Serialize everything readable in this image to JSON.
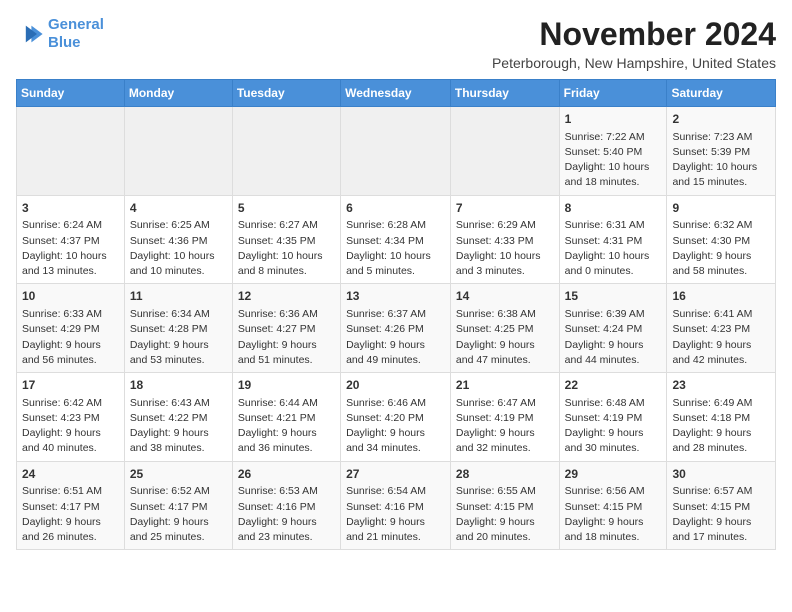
{
  "logo": {
    "line1": "General",
    "line2": "Blue"
  },
  "title": "November 2024",
  "location": "Peterborough, New Hampshire, United States",
  "weekdays": [
    "Sunday",
    "Monday",
    "Tuesday",
    "Wednesday",
    "Thursday",
    "Friday",
    "Saturday"
  ],
  "weeks": [
    [
      {
        "day": "",
        "info": ""
      },
      {
        "day": "",
        "info": ""
      },
      {
        "day": "",
        "info": ""
      },
      {
        "day": "",
        "info": ""
      },
      {
        "day": "",
        "info": ""
      },
      {
        "day": "1",
        "info": "Sunrise: 7:22 AM\nSunset: 5:40 PM\nDaylight: 10 hours and 18 minutes."
      },
      {
        "day": "2",
        "info": "Sunrise: 7:23 AM\nSunset: 5:39 PM\nDaylight: 10 hours and 15 minutes."
      }
    ],
    [
      {
        "day": "3",
        "info": "Sunrise: 6:24 AM\nSunset: 4:37 PM\nDaylight: 10 hours and 13 minutes."
      },
      {
        "day": "4",
        "info": "Sunrise: 6:25 AM\nSunset: 4:36 PM\nDaylight: 10 hours and 10 minutes."
      },
      {
        "day": "5",
        "info": "Sunrise: 6:27 AM\nSunset: 4:35 PM\nDaylight: 10 hours and 8 minutes."
      },
      {
        "day": "6",
        "info": "Sunrise: 6:28 AM\nSunset: 4:34 PM\nDaylight: 10 hours and 5 minutes."
      },
      {
        "day": "7",
        "info": "Sunrise: 6:29 AM\nSunset: 4:33 PM\nDaylight: 10 hours and 3 minutes."
      },
      {
        "day": "8",
        "info": "Sunrise: 6:31 AM\nSunset: 4:31 PM\nDaylight: 10 hours and 0 minutes."
      },
      {
        "day": "9",
        "info": "Sunrise: 6:32 AM\nSunset: 4:30 PM\nDaylight: 9 hours and 58 minutes."
      }
    ],
    [
      {
        "day": "10",
        "info": "Sunrise: 6:33 AM\nSunset: 4:29 PM\nDaylight: 9 hours and 56 minutes."
      },
      {
        "day": "11",
        "info": "Sunrise: 6:34 AM\nSunset: 4:28 PM\nDaylight: 9 hours and 53 minutes."
      },
      {
        "day": "12",
        "info": "Sunrise: 6:36 AM\nSunset: 4:27 PM\nDaylight: 9 hours and 51 minutes."
      },
      {
        "day": "13",
        "info": "Sunrise: 6:37 AM\nSunset: 4:26 PM\nDaylight: 9 hours and 49 minutes."
      },
      {
        "day": "14",
        "info": "Sunrise: 6:38 AM\nSunset: 4:25 PM\nDaylight: 9 hours and 47 minutes."
      },
      {
        "day": "15",
        "info": "Sunrise: 6:39 AM\nSunset: 4:24 PM\nDaylight: 9 hours and 44 minutes."
      },
      {
        "day": "16",
        "info": "Sunrise: 6:41 AM\nSunset: 4:23 PM\nDaylight: 9 hours and 42 minutes."
      }
    ],
    [
      {
        "day": "17",
        "info": "Sunrise: 6:42 AM\nSunset: 4:23 PM\nDaylight: 9 hours and 40 minutes."
      },
      {
        "day": "18",
        "info": "Sunrise: 6:43 AM\nSunset: 4:22 PM\nDaylight: 9 hours and 38 minutes."
      },
      {
        "day": "19",
        "info": "Sunrise: 6:44 AM\nSunset: 4:21 PM\nDaylight: 9 hours and 36 minutes."
      },
      {
        "day": "20",
        "info": "Sunrise: 6:46 AM\nSunset: 4:20 PM\nDaylight: 9 hours and 34 minutes."
      },
      {
        "day": "21",
        "info": "Sunrise: 6:47 AM\nSunset: 4:19 PM\nDaylight: 9 hours and 32 minutes."
      },
      {
        "day": "22",
        "info": "Sunrise: 6:48 AM\nSunset: 4:19 PM\nDaylight: 9 hours and 30 minutes."
      },
      {
        "day": "23",
        "info": "Sunrise: 6:49 AM\nSunset: 4:18 PM\nDaylight: 9 hours and 28 minutes."
      }
    ],
    [
      {
        "day": "24",
        "info": "Sunrise: 6:51 AM\nSunset: 4:17 PM\nDaylight: 9 hours and 26 minutes."
      },
      {
        "day": "25",
        "info": "Sunrise: 6:52 AM\nSunset: 4:17 PM\nDaylight: 9 hours and 25 minutes."
      },
      {
        "day": "26",
        "info": "Sunrise: 6:53 AM\nSunset: 4:16 PM\nDaylight: 9 hours and 23 minutes."
      },
      {
        "day": "27",
        "info": "Sunrise: 6:54 AM\nSunset: 4:16 PM\nDaylight: 9 hours and 21 minutes."
      },
      {
        "day": "28",
        "info": "Sunrise: 6:55 AM\nSunset: 4:15 PM\nDaylight: 9 hours and 20 minutes."
      },
      {
        "day": "29",
        "info": "Sunrise: 6:56 AM\nSunset: 4:15 PM\nDaylight: 9 hours and 18 minutes."
      },
      {
        "day": "30",
        "info": "Sunrise: 6:57 AM\nSunset: 4:15 PM\nDaylight: 9 hours and 17 minutes."
      }
    ]
  ]
}
